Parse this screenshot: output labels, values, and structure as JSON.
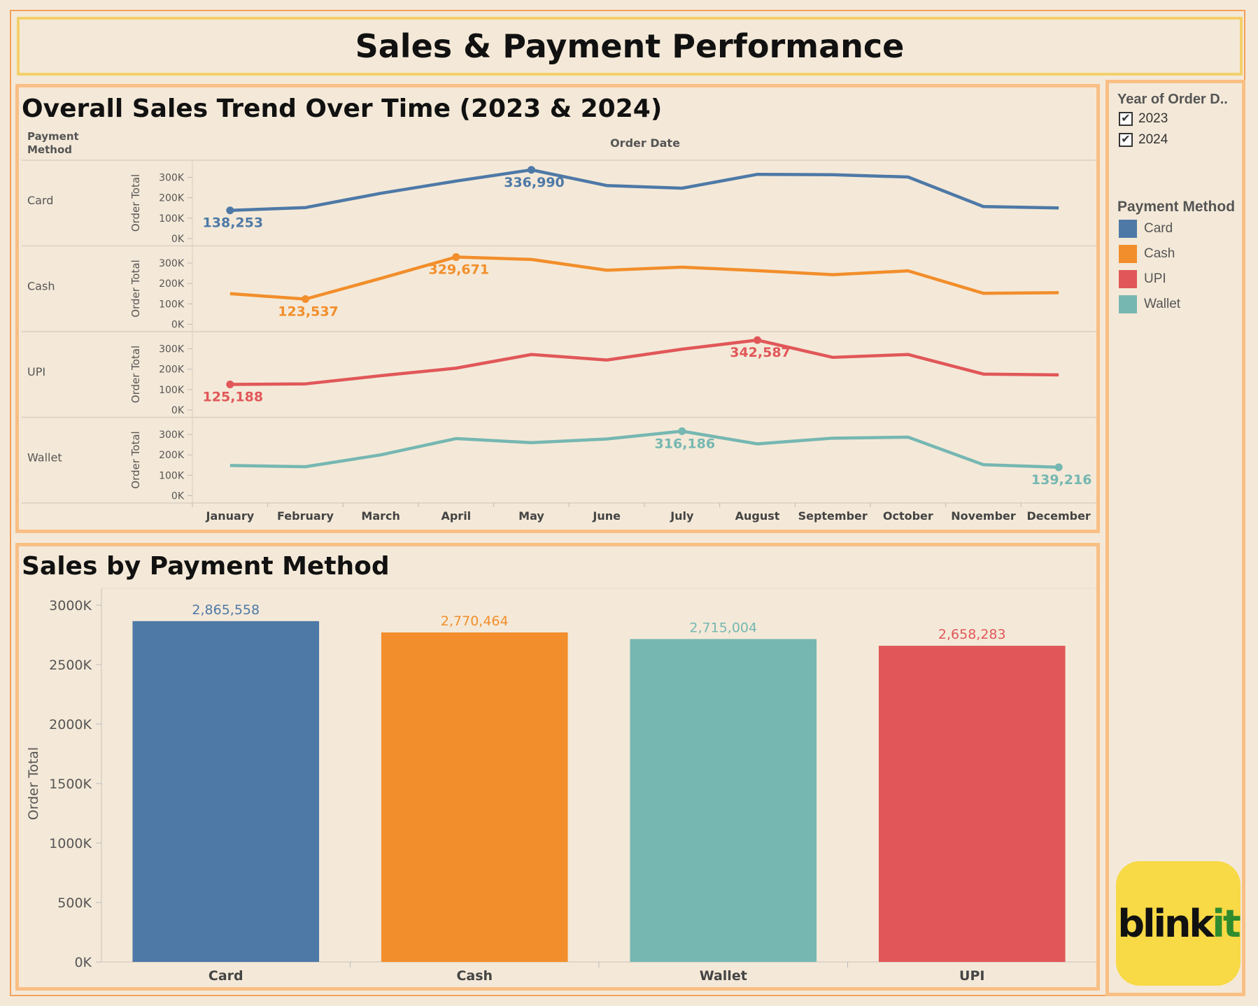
{
  "dashboard_title": "Sales & Payment Performance",
  "trend_panel": {
    "title": "Overall Sales Trend Over Time (2023 & 2024)",
    "row_header": "Payment Method",
    "column_header": "Order Date",
    "y_axis_label": "Order Total"
  },
  "bar_panel": {
    "title": "Sales by Payment Method"
  },
  "filter": {
    "title": "Year of Order D..",
    "options": [
      {
        "label": "2023",
        "checked": true
      },
      {
        "label": "2024",
        "checked": true
      }
    ]
  },
  "legend": {
    "title": "Payment Method",
    "items": [
      {
        "label": "Card",
        "color": "#4e79a7"
      },
      {
        "label": "Cash",
        "color": "#f28e2b"
      },
      {
        "label": "UPI",
        "color": "#e15759"
      },
      {
        "label": "Wallet",
        "color": "#76b7b2"
      }
    ]
  },
  "logo": {
    "text_dark": "blink",
    "text_green": "it"
  },
  "chart_data": [
    {
      "type": "line",
      "title": "Overall Sales Trend Over Time (2023 & 2024)",
      "xlabel": "Order Date",
      "ylabel": "Order Total",
      "x": [
        "January",
        "February",
        "March",
        "April",
        "May",
        "June",
        "July",
        "August",
        "September",
        "October",
        "November",
        "December"
      ],
      "y_ticks": [
        "0K",
        "100K",
        "200K",
        "300K"
      ],
      "ylim": [
        0,
        350000
      ],
      "series": [
        {
          "name": "Card",
          "color": "#4e79a7",
          "values": [
            138253,
            152000,
            222000,
            282000,
            336990,
            260000,
            247000,
            315000,
            313000,
            302000,
            157000,
            150000
          ],
          "labels": [
            {
              "index": 0,
              "text": "138,253",
              "pos": "below"
            },
            {
              "index": 4,
              "text": "336,990",
              "pos": "below"
            }
          ]
        },
        {
          "name": "Cash",
          "color": "#f28e2b",
          "values": [
            150000,
            123537,
            225000,
            329671,
            318000,
            265000,
            280000,
            263000,
            243000,
            262000,
            152000,
            155000
          ],
          "labels": [
            {
              "index": 1,
              "text": "123,537",
              "pos": "below"
            },
            {
              "index": 3,
              "text": "329,671",
              "pos": "below"
            }
          ]
        },
        {
          "name": "UPI",
          "color": "#e15759",
          "values": [
            125188,
            128000,
            168000,
            205000,
            272000,
            245000,
            298000,
            342587,
            258000,
            272000,
            176000,
            172000
          ],
          "labels": [
            {
              "index": 0,
              "text": "125,188",
              "pos": "below"
            },
            {
              "index": 7,
              "text": "342,587",
              "pos": "below"
            }
          ]
        },
        {
          "name": "Wallet",
          "color": "#76b7b2",
          "values": [
            148000,
            142000,
            200000,
            280000,
            260000,
            278000,
            316186,
            254000,
            282000,
            287000,
            152000,
            139216
          ],
          "labels": [
            {
              "index": 6,
              "text": "316,186",
              "pos": "below"
            },
            {
              "index": 11,
              "text": "139,216",
              "pos": "below"
            }
          ]
        }
      ]
    },
    {
      "type": "bar",
      "title": "Sales by Payment Method",
      "ylabel": "Order Total",
      "categories": [
        "Card",
        "Cash",
        "Wallet",
        "UPI"
      ],
      "values": [
        2865558,
        2770464,
        2715004,
        2658283
      ],
      "value_labels": [
        "2,865,558",
        "2,770,464",
        "2,715,004",
        "2,658,283"
      ],
      "colors": [
        "#4e79a7",
        "#f28e2b",
        "#76b7b2",
        "#e15759"
      ],
      "y_ticks": [
        "0K",
        "500K",
        "1000K",
        "1500K",
        "2000K",
        "2500K",
        "3000K"
      ],
      "ylim": [
        0,
        3000000
      ]
    }
  ]
}
